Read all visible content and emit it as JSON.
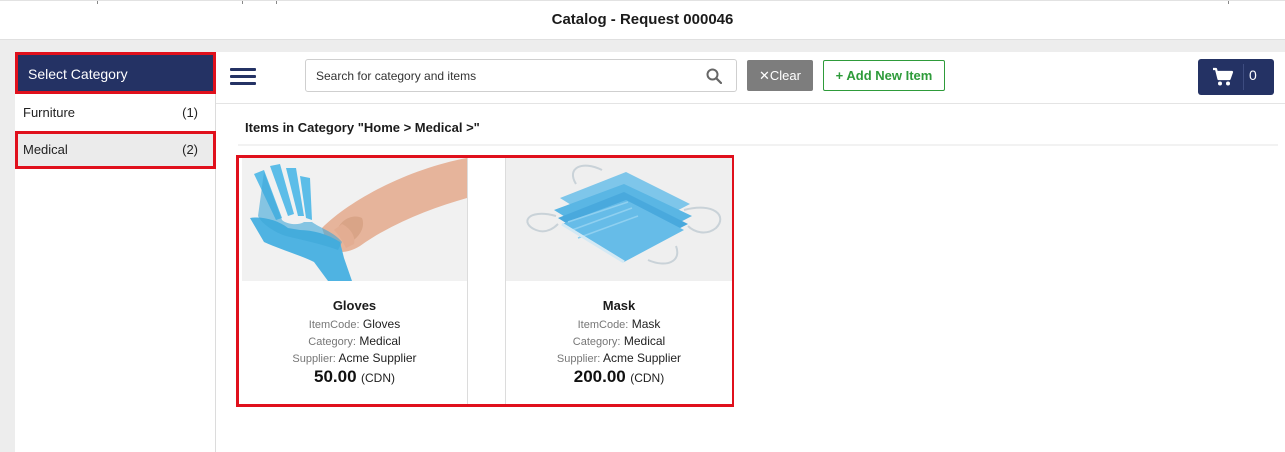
{
  "header": {
    "title": "Catalog - Request 000046"
  },
  "sidebar": {
    "title": "Select Category",
    "items": [
      {
        "label": "Furniture",
        "count": "(1)"
      },
      {
        "label": "Medical",
        "count": "(2)"
      }
    ]
  },
  "toolbar": {
    "search_placeholder": "Search for category and items",
    "clear_label": "Clear",
    "add_label": "Add New Item",
    "cart_count": "0"
  },
  "main": {
    "heading": "Items in Category \"Home > Medical >\"",
    "items": [
      {
        "name": "Gloves",
        "itemcode_key": "ItemCode:",
        "itemcode": "Gloves",
        "category_key": "Category:",
        "category": "Medical",
        "supplier_key": "Supplier:",
        "supplier": "Acme Supplier",
        "price": "50.00",
        "currency": "(CDN)"
      },
      {
        "name": "Mask",
        "itemcode_key": "ItemCode:",
        "itemcode": "Mask",
        "category_key": "Category:",
        "category": "Medical",
        "supplier_key": "Supplier:",
        "supplier": "Acme Supplier",
        "price": "200.00",
        "currency": "(CDN)"
      }
    ]
  },
  "icons": {
    "menu": "hamburger-menu-icon",
    "search": "search-icon",
    "clear": "close-icon",
    "add": "plus-icon",
    "cart": "cart-icon"
  },
  "colors": {
    "navy": "#243264",
    "highlight": "#e0101c",
    "green": "#2e9b3a",
    "clear_gray": "#7d7d7d"
  }
}
